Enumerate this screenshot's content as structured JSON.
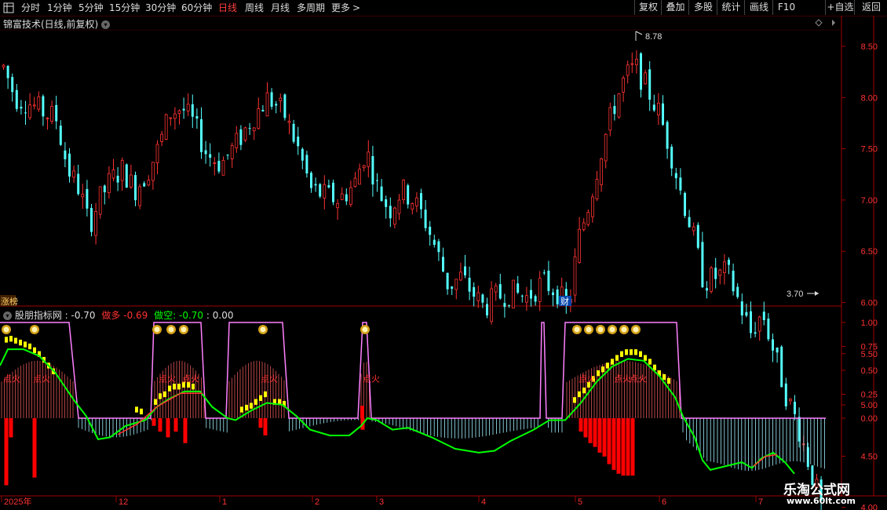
{
  "toolbar": {
    "periods": [
      {
        "label": "分时",
        "x": 27
      },
      {
        "label": "1分钟",
        "x": 60
      },
      {
        "label": "5分钟",
        "x": 100
      },
      {
        "label": "15分钟",
        "x": 139
      },
      {
        "label": "30分钟",
        "x": 185
      },
      {
        "label": "60分钟",
        "x": 231
      },
      {
        "label": "日线",
        "x": 278,
        "active": true
      },
      {
        "label": "周线",
        "x": 312
      },
      {
        "label": "月线",
        "x": 345
      },
      {
        "label": "多周期",
        "x": 378
      },
      {
        "label": "更多",
        "x": 422
      }
    ],
    "more_arrow": ">",
    "buttons": [
      "复权",
      "叠加",
      "多股",
      "统计",
      "画线",
      "F10",
      "+自选",
      "返回"
    ],
    "menu_icon": "grid-icon"
  },
  "main": {
    "title": "锦富技术(日线,前复权)",
    "high_label": "8.78",
    "low_label": "3.70",
    "yticks": [
      "8.50",
      "8.00",
      "7.50",
      "7.00",
      "6.50",
      "6.00",
      "5.50",
      "5.00",
      "4.50",
      "4.00"
    ],
    "finance_marker": "财",
    "left_marker": "涨榜"
  },
  "indicator": {
    "name": "股朋指标网",
    "value": "-0.70",
    "long_label": "做多",
    "long_value": "-0.69",
    "short_label": "做空",
    "short_value": "-0.70",
    "extra_value": "0.00",
    "yticks": [
      "1.00",
      "0.75",
      "0.50",
      "0.25",
      "0.00"
    ],
    "signal_text": "点火"
  },
  "xaxis": {
    "labels": [
      "2025年",
      "12",
      "1",
      "2",
      "3",
      "4",
      "5",
      "6",
      "7"
    ]
  },
  "watermark": {
    "cn": "乐淘公式网",
    "url": "www.60lt.com"
  },
  "colors": {
    "up": "#ff3232",
    "down": "#54ffff",
    "green_line": "#00ff00",
    "pink": "#ff80ff",
    "yellow": "#ffff00",
    "axis_red": "#a00000"
  }
}
